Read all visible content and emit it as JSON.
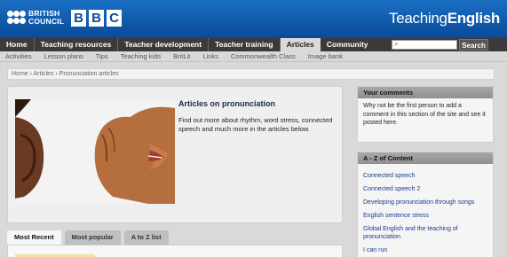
{
  "header": {
    "bc_line1": "BRITISH",
    "bc_line2": "COUNCIL",
    "bbc_letters": [
      "B",
      "B",
      "C"
    ],
    "te_plain": "Teaching",
    "te_bold": "English"
  },
  "nav": {
    "items": [
      "Home",
      "Teaching resources",
      "Teacher development",
      "Teacher training",
      "Articles",
      "Community"
    ],
    "active": "Articles",
    "search_placeholder": "",
    "search_button": "Search"
  },
  "subnav": {
    "items": [
      "Activities",
      "Lesson plans",
      "Tips",
      "Teaching kids",
      "BritLit",
      "Links",
      "Commonwealth Class",
      "Image bank"
    ]
  },
  "breadcrumb": "Home › Articles › Pronunciation articles",
  "intro": {
    "title": "Articles on pronunciation",
    "text": "Find out more about rhythm, word stress, connected speech and much more in the articles below."
  },
  "tabs": [
    "Most Recent",
    "Most popular",
    "A to Z list"
  ],
  "comments": {
    "heading": "Your comments",
    "text": "Why not be the first person to add a comment in this section of the site and see it posted here."
  },
  "az": {
    "heading": "A - Z of Content",
    "links": [
      "Connected speech",
      "Connected speech 2",
      "Developing pronunciation through songs",
      "English sentence stress",
      "Global English and the teaching of pronunciation",
      "I can run"
    ]
  },
  "colors": {
    "header_blue": "#0a4a99",
    "nav_dark": "#3a3a3a",
    "link_blue": "#1a3a8a"
  }
}
